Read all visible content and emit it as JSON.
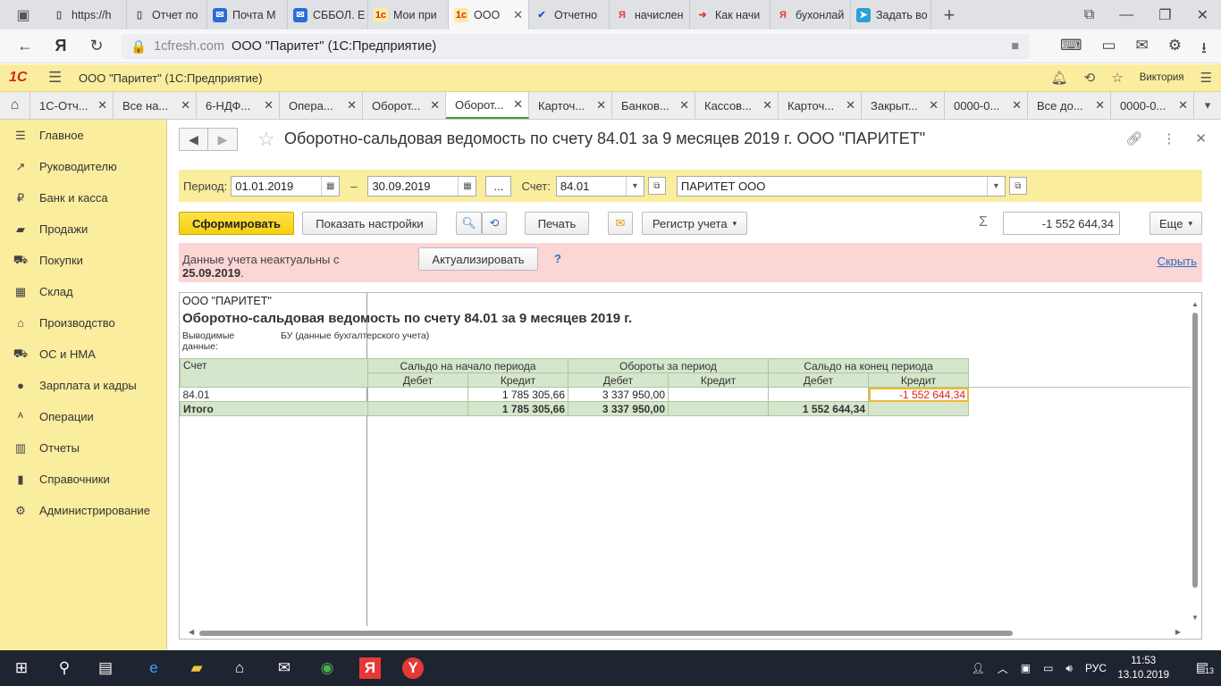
{
  "browser": {
    "tabs": [
      {
        "label": "https://h",
        "icon": "page-icon"
      },
      {
        "label": "Отчет по",
        "icon": "page-icon"
      },
      {
        "label": "Почта М",
        "icon": "mail-icon"
      },
      {
        "label": "СББОЛ. Е",
        "icon": "mail-icon"
      },
      {
        "label": "Мои при",
        "icon": "1c-icon"
      },
      {
        "label": "ООО",
        "icon": "1c-icon",
        "active": true
      },
      {
        "label": "Отчетно",
        "icon": "checkmark-icon"
      },
      {
        "label": "начислен",
        "icon": "yandex-icon"
      },
      {
        "label": "Как начи",
        "icon": "arrow-icon"
      },
      {
        "label": "бухонлай",
        "icon": "yandex-icon"
      },
      {
        "label": "Задать во",
        "icon": "telegram-icon"
      }
    ],
    "url_domain": "1cfresh.com",
    "url_title": "ООО \"Паритет\" (1С:Предприятие)"
  },
  "app": {
    "logo": "1С",
    "org_title": "ООО \"Паритет\"  (1С:Предприятие)",
    "user": "Виктория"
  },
  "app_tabs": [
    "1С-Отч...",
    "Все на...",
    "6-НДФ...",
    "Опера...",
    "Оборот...",
    "Оборот...",
    "Карточ...",
    "Банков...",
    "Кассов...",
    "Карточ...",
    "Закрыт...",
    "0000-0...",
    "Все до...",
    "0000-0..."
  ],
  "app_tabs_active": 5,
  "sidebar": {
    "items": [
      {
        "label": "Главное",
        "icon": "menu-icon"
      },
      {
        "label": "Руководителю",
        "icon": "chart-line-icon"
      },
      {
        "label": "Банк и касса",
        "icon": "ruble-icon"
      },
      {
        "label": "Продажи",
        "icon": "bag-icon"
      },
      {
        "label": "Покупки",
        "icon": "cart-icon"
      },
      {
        "label": "Склад",
        "icon": "grid-icon"
      },
      {
        "label": "Производство",
        "icon": "factory-icon"
      },
      {
        "label": "ОС и НМА",
        "icon": "truck-icon"
      },
      {
        "label": "Зарплата и кадры",
        "icon": "person-icon"
      },
      {
        "label": "Операции",
        "icon": "operations-icon"
      },
      {
        "label": "Отчеты",
        "icon": "bar-chart-icon"
      },
      {
        "label": "Справочники",
        "icon": "book-icon"
      },
      {
        "label": "Администрирование",
        "icon": "gear-icon"
      }
    ]
  },
  "form": {
    "title": "Оборотно-сальдовая ведомость по счету 84.01 за 9 месяцев 2019 г. ООО \"ПАРИТЕТ\"",
    "period_label": "Период:",
    "date_from": "01.01.2019",
    "dash": "–",
    "date_to": "30.09.2019",
    "ellipsis": "...",
    "account_label": "Счет:",
    "account": "84.01",
    "organization": "ПАРИТЕТ ООО"
  },
  "commands": {
    "generate": "Сформировать",
    "show_settings": "Показать настройки",
    "print": "Печать",
    "register": "Регистр учета",
    "sum_value": "-1 552 644,34",
    "more": "Еще"
  },
  "warning": {
    "text": "Данные учета неактуальны с",
    "date": "25.09.2019",
    "actualize": "Актуализировать",
    "help": "?",
    "hide": "Скрыть"
  },
  "report": {
    "org": "ООО \"ПАРИТЕТ\"",
    "title": "Оборотно-сальдовая ведомость по счету 84.01 за 9 месяцев 2019 г.",
    "meta_label": "Выводимые данные:",
    "meta_value": "БУ (данные бухгалтерского учета)",
    "col_account": "Счет",
    "groups": [
      "Сальдо на начало периода",
      "Обороты за период",
      "Сальдо на конец периода"
    ],
    "subcols": [
      "Дебет",
      "Кредит",
      "Дебет",
      "Кредит",
      "Дебет",
      "Кредит"
    ],
    "rows": [
      {
        "account": "84.01",
        "values": [
          "",
          "1 785 305,66",
          "3 337 950,00",
          "",
          "",
          "-1 552 644,34"
        ]
      }
    ],
    "total": {
      "label": "Итого",
      "values": [
        "",
        "1 785 305,66",
        "3 337 950,00",
        "",
        "1 552 644,34",
        ""
      ]
    }
  },
  "taskbar": {
    "lang": "РУС",
    "time": "11:53",
    "date": "13.10.2019",
    "notif_count": "13"
  }
}
